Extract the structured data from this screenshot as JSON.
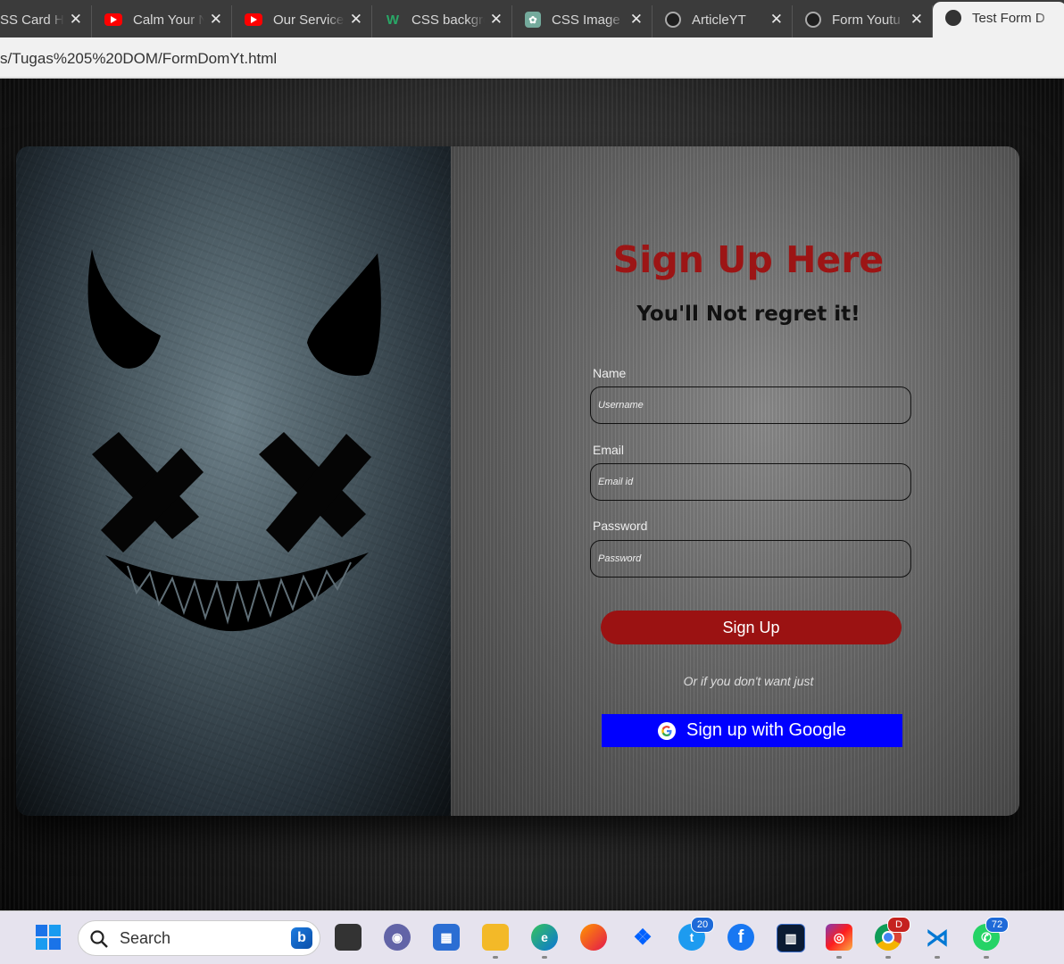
{
  "browser": {
    "tabs": [
      {
        "title": "SS Card H",
        "favicon": "globe-icon"
      },
      {
        "title": "Calm Your N",
        "favicon": "youtube-icon"
      },
      {
        "title": "Our Service",
        "favicon": "youtube-icon"
      },
      {
        "title": "CSS backgro",
        "favicon": "w3-icon"
      },
      {
        "title": "CSS Image |",
        "favicon": "chatgpt-icon"
      },
      {
        "title": "ArticleYT",
        "favicon": "globe-icon"
      },
      {
        "title": "Form Youtu",
        "favicon": "globe-icon"
      },
      {
        "title": "Test Form D",
        "favicon": "globe-icon",
        "active": true
      }
    ],
    "url": "s/Tugas%205%20DOM/FormDomYt.html"
  },
  "page": {
    "heading": "Sign Up Here",
    "subheading": "You'll Not regret it!",
    "form": {
      "name_label": "Name",
      "name_placeholder": "Username",
      "email_label": "Email",
      "email_placeholder": "Email id",
      "password_label": "Password",
      "password_placeholder": "Password",
      "signup_label": "Sign Up",
      "alt_text": "Or if you don't want just",
      "google_label": "Sign up with Google"
    },
    "colors": {
      "heading": "#9c1515",
      "signup_button": "#9b1212",
      "google_button": "#0000ff"
    }
  },
  "taskbar": {
    "search_placeholder": "Search",
    "badges": {
      "twitter": "20",
      "whatsapp": "72",
      "chrome": "D"
    }
  }
}
